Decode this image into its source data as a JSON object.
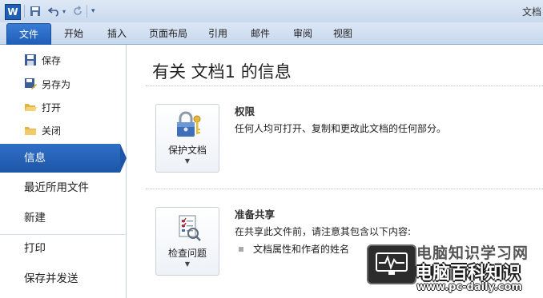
{
  "titlebar": {
    "app_icon_letter": "W",
    "title": "文档"
  },
  "ribbon": {
    "tabs": [
      "文件",
      "开始",
      "插入",
      "页面布局",
      "引用",
      "邮件",
      "审阅",
      "视图"
    ]
  },
  "backstage": {
    "small_items": [
      {
        "label": "保存",
        "icon": "save-icon"
      },
      {
        "label": "另存为",
        "icon": "save-as-icon"
      },
      {
        "label": "打开",
        "icon": "open-folder-icon"
      },
      {
        "label": "关闭",
        "icon": "close-folder-icon"
      }
    ],
    "big_items": [
      {
        "label": "信息",
        "selected": true
      },
      {
        "label": "最近所用文件",
        "selected": false
      },
      {
        "label": "新建",
        "selected": false
      },
      {
        "label": "打印",
        "selected": false
      },
      {
        "label": "保存并发送",
        "selected": false
      }
    ]
  },
  "main": {
    "heading": "有关 文档1 的信息",
    "permissions": {
      "button_label": "保护文档",
      "title": "权限",
      "description": "任何人均可打开、复制和更改此文档的任何部分。"
    },
    "prepare": {
      "button_label": "检查问题",
      "title": "准备共享",
      "description": "在共享此文件前，请注意其包含以下内容:",
      "bullets": [
        "文档属性和作者的姓名"
      ]
    }
  },
  "watermark": {
    "top": "电脑知识学习网",
    "main": "电脑百科知识",
    "url": "www.pc-daily.com"
  },
  "colors": {
    "accent": "#1d56a8",
    "file_tab": "#2f6fc6"
  }
}
